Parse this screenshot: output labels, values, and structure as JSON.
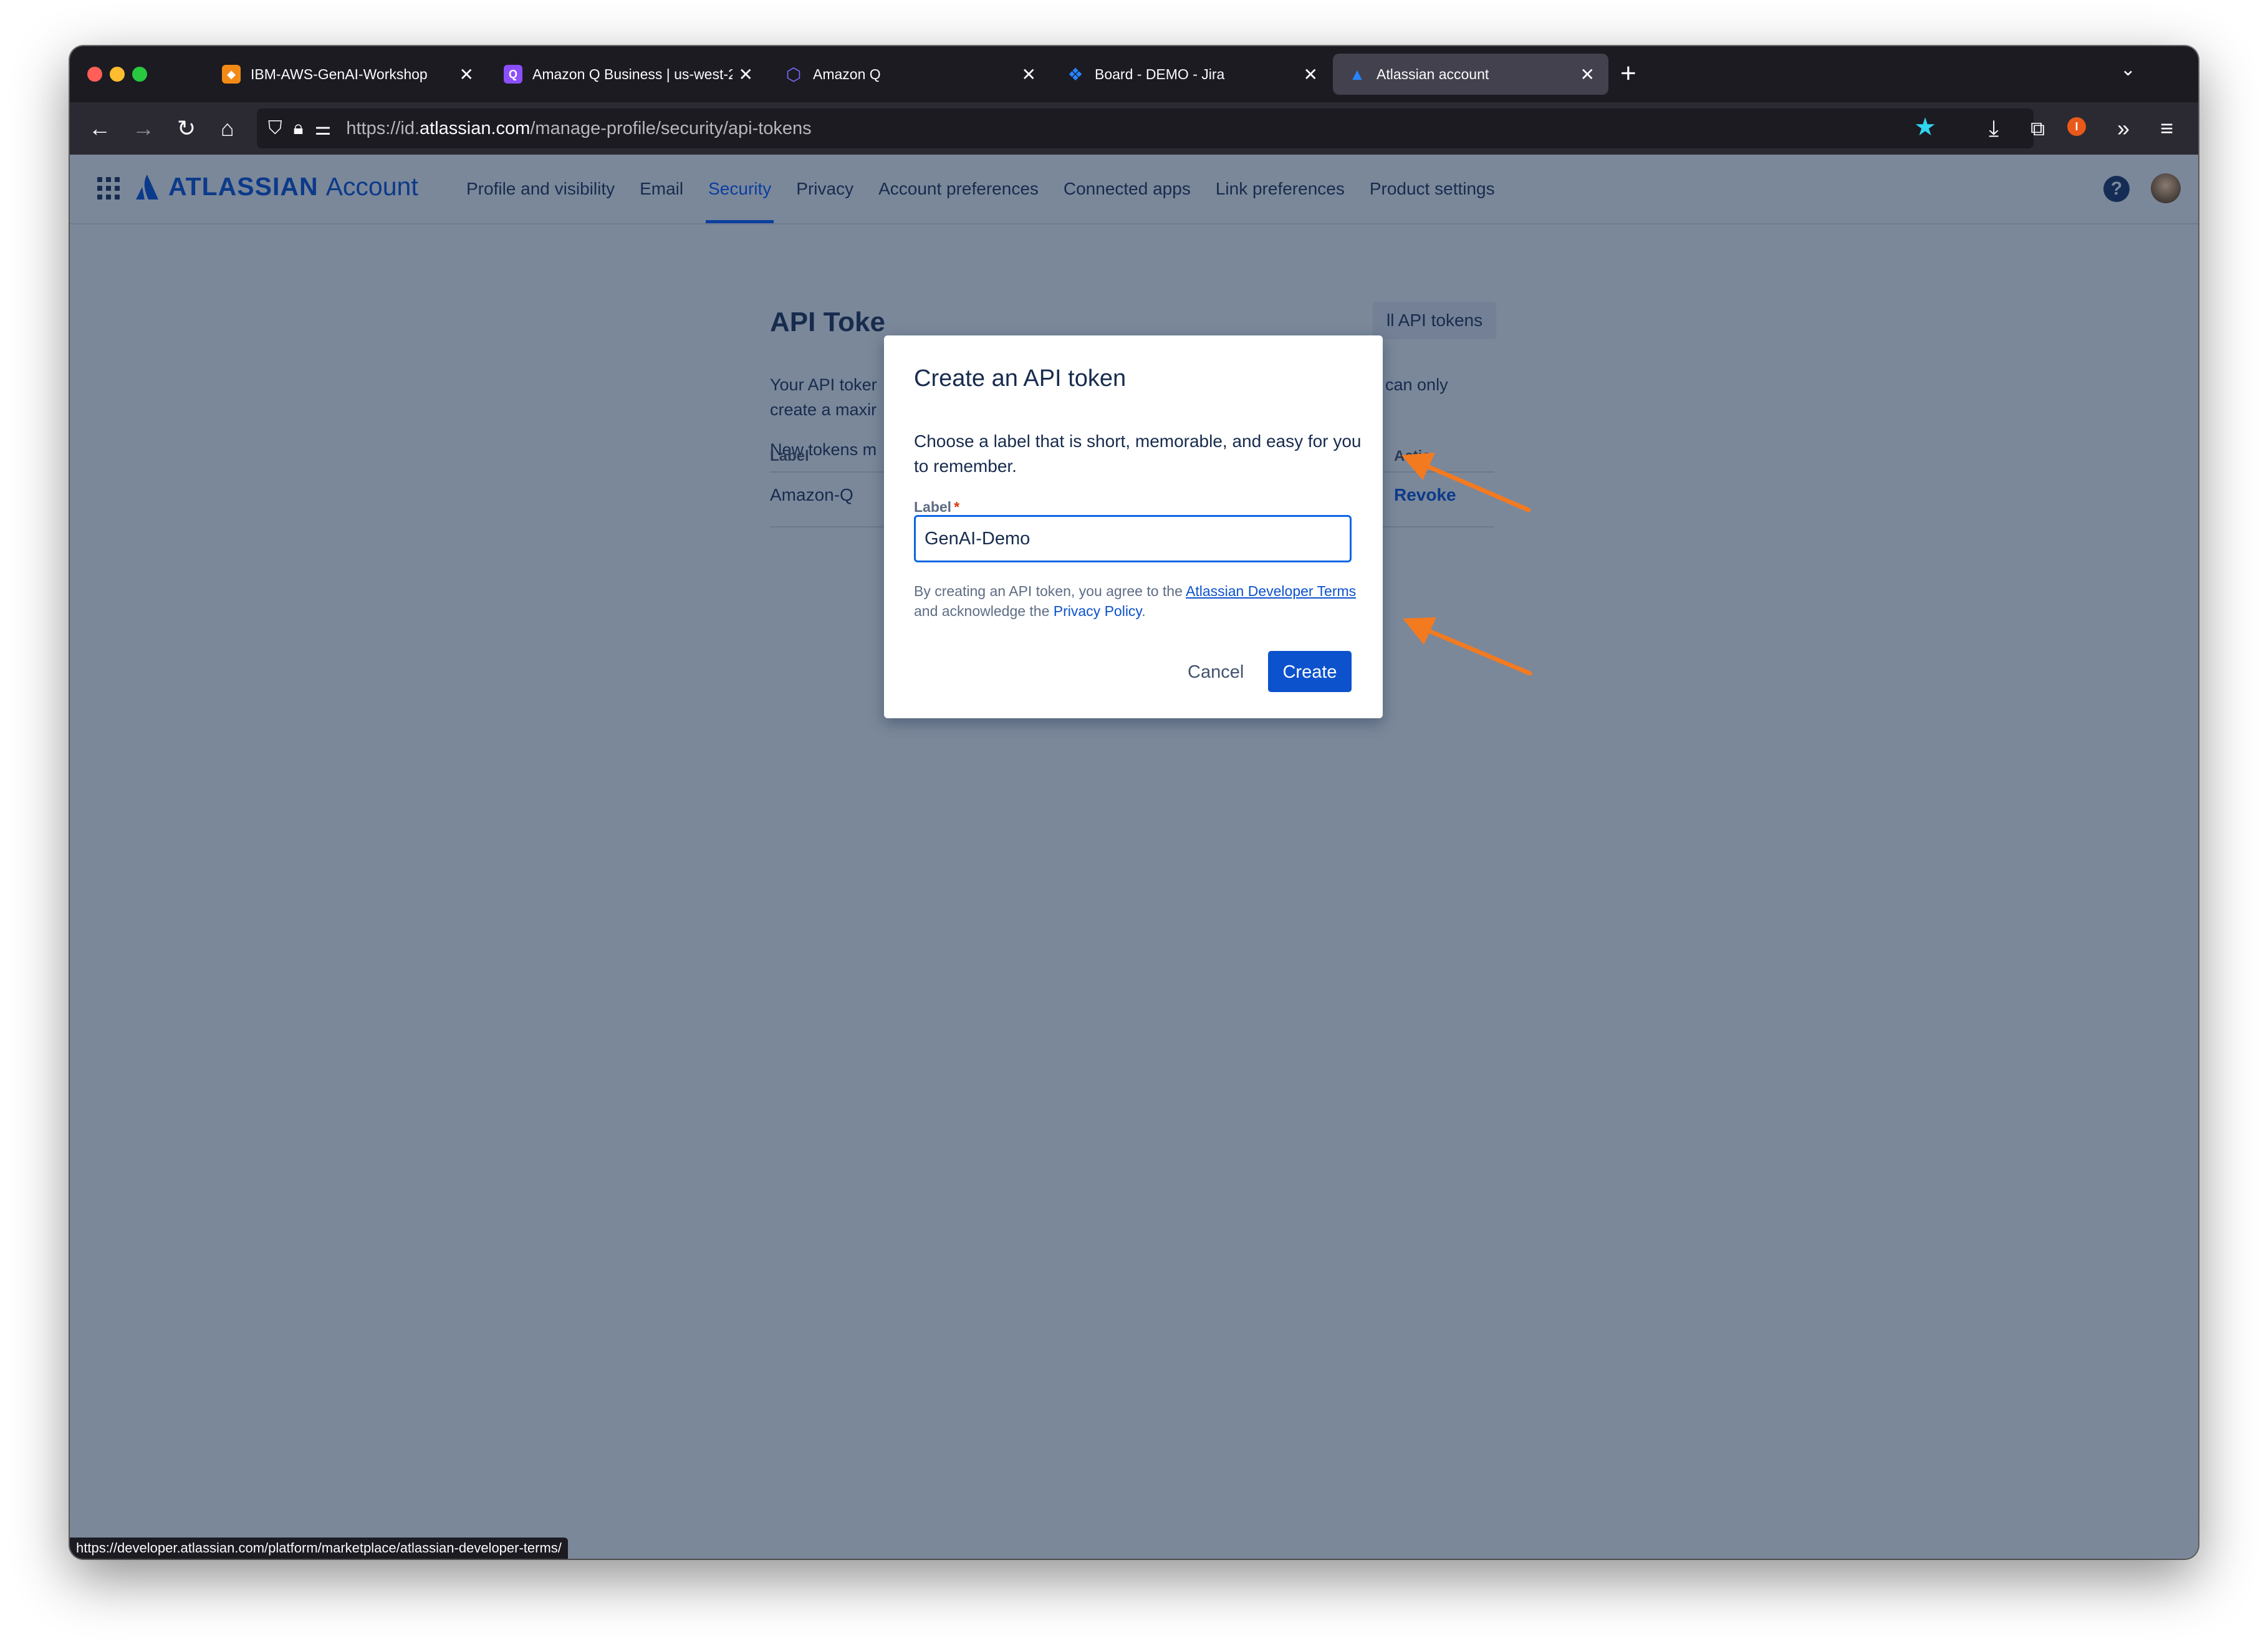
{
  "browser": {
    "tabs": [
      {
        "title": "IBM-AWS-GenAI-Workshop",
        "favicon": "aws-cube-icon",
        "color": "#f48a16"
      },
      {
        "title": "Amazon Q Business | us-west-2",
        "favicon": "amazon-q-icon",
        "color": "#8c4fff"
      },
      {
        "title": "Amazon Q",
        "favicon": "amazon-q-hex-icon",
        "color": "#7a6cff"
      },
      {
        "title": "Board - DEMO - Jira",
        "favicon": "jira-icon",
        "color": "#2684ff"
      },
      {
        "title": "Atlassian account",
        "favicon": "atlassian-icon",
        "color": "#2684ff"
      }
    ],
    "url_prefix": "https://id.",
    "url_domain": "atlassian.com",
    "url_path": "/manage-profile/security/api-tokens",
    "status_url": "https://developer.atlassian.com/platform/marketplace/atlassian-developer-terms/"
  },
  "header": {
    "brand": "ATLASSIAN",
    "product": "Account",
    "nav": [
      "Profile and visibility",
      "Email",
      "Security",
      "Privacy",
      "Account preferences",
      "Connected apps",
      "Link preferences",
      "Product settings"
    ],
    "active_nav": "Security"
  },
  "background": {
    "title": "API Toke",
    "line1": "Your API toker",
    "line1_tail": "can only",
    "line2": "create a maxir",
    "line3": "New tokens m",
    "revoke_all_button": "ll API tokens",
    "col_label": "Label",
    "col_actions": "Actio",
    "row_label": "Amazon-Q",
    "row_action": "Revoke"
  },
  "modal": {
    "title": "Create an API token",
    "description": "Choose a label that is short, memorable, and easy for you to remember.",
    "field_label": "Label",
    "field_value": "GenAI-Demo",
    "terms_prefix": "By creating an API token, you agree to the ",
    "terms_link": "Atlassian Developer Terms",
    "terms_middle": " and acknowledge the ",
    "privacy_link": "Privacy Policy",
    "terms_suffix": ".",
    "cancel_label": "Cancel",
    "create_label": "Create"
  },
  "colors": {
    "accent": "#0c52cc",
    "annotation_arrow": "#f47a20"
  }
}
